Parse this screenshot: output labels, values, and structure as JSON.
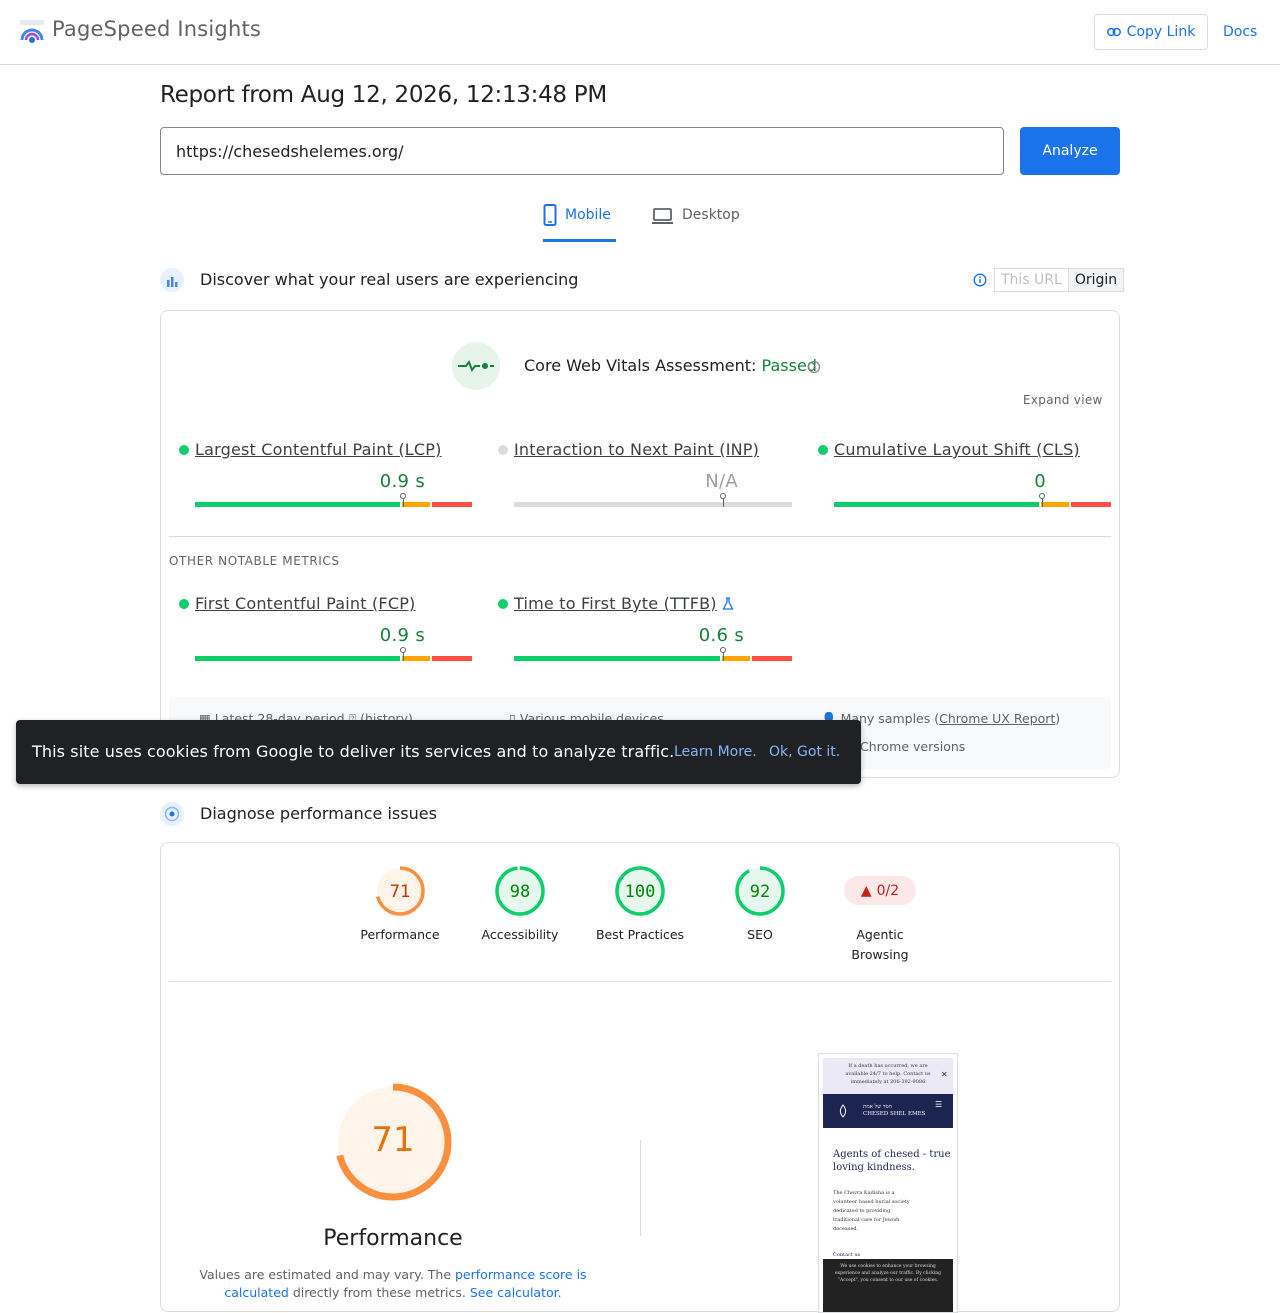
{
  "header": {
    "app_title": "PageSpeed Insights",
    "copy_link": "Copy Link",
    "docs": "Docs"
  },
  "report": {
    "title": "Report from Aug 12, 2026, 12:13:48 PM",
    "url": "https://chesedshelemes.org/",
    "analyze": "Analyze"
  },
  "tabs": [
    {
      "label": "Mobile",
      "active": true
    },
    {
      "label": "Desktop",
      "active": false
    }
  ],
  "field": {
    "section_title": "Discover what your real users are experiencing",
    "toggle_this_url": "This URL",
    "toggle_origin": "Origin",
    "cwv_label": "Core Web Vitals Assessment: ",
    "cwv_status": "Passed",
    "expand_view": "Expand view",
    "other_label": "OTHER NOTABLE METRICS",
    "metrics": [
      {
        "name": "Largest Contentful Paint (LCP)",
        "value": "0.9 s",
        "status": "good",
        "good_fraction": 0.74
      },
      {
        "name": "Interaction to Next Paint (INP)",
        "value": "N/A",
        "status": "na"
      },
      {
        "name": "Cumulative Layout Shift (CLS)",
        "value": "0",
        "status": "good",
        "good_fraction": 0.74
      },
      {
        "name": "First Contentful Paint (FCP)",
        "value": "0.9 s",
        "status": "good",
        "good_fraction": 0.74
      },
      {
        "name": "Time to First Byte (TTFB)",
        "value": "0.6 s",
        "status": "good",
        "good_fraction": 0.74
      }
    ],
    "footer": {
      "period": "Latest 28-day period",
      "history": "(history)",
      "devices": "Various mobile devices",
      "samples_prefix": "Many samples (",
      "samples_link": "Chrome UX Report",
      "samples_suffix": ")",
      "chrome": "Chrome versions"
    }
  },
  "cookie": {
    "text": "This site uses cookies from Google to deliver its services and to analyze traffic.",
    "learn_more": "Learn More.",
    "ok": "Ok, Got it."
  },
  "diagnose": {
    "section_title": "Diagnose performance issues",
    "scores": [
      {
        "label": "Performance",
        "value": 71,
        "color": "#fa903e"
      },
      {
        "label": "Accessibility",
        "value": 98,
        "color": "#0cce6b"
      },
      {
        "label": "Best Practices",
        "value": 100,
        "color": "#0cce6b"
      },
      {
        "label": "SEO",
        "value": 92,
        "color": "#0cce6b"
      }
    ],
    "agentic": {
      "value": "0/2",
      "label_line1": "Agentic",
      "label_line2": "Browsing"
    },
    "main_score": {
      "value": 71,
      "title": "Performance",
      "color": "#fa903e"
    },
    "disclaimer": {
      "text1": "Values are estimated and may vary. The ",
      "link1": "performance score is calculated",
      "text2": " directly from these metrics. ",
      "link2": "See calculator."
    }
  },
  "screenshot": {
    "banner": "If a death has occurred, we are available 24/7 to help. Contact us immediately at 206-392-9086",
    "nav_line1": "חסד של אמת",
    "nav_line2": "CHESED SHEL EMES",
    "headline": "Agents of chesed - true loving kindness.",
    "body": "The Chevra Kadisha is a volunteer based burial society dedicated to providing traditional care for Jewish deceased.",
    "contact": "Contact us",
    "cookie": "We use cookies to enhance your browsing experience and analyze our traffic. By clicking \"Accept\", you consent to our use of cookies."
  },
  "colors": {
    "accent": "#1a73e8",
    "good": "#0cce6b",
    "average": "#ffa400",
    "poor": "#ff4e42",
    "good_text": "#188038"
  }
}
